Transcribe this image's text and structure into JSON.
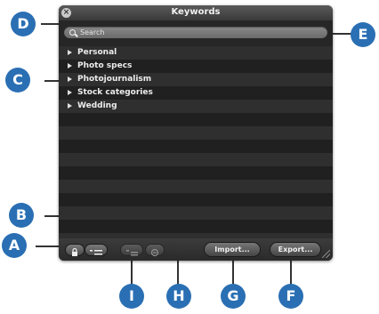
{
  "window": {
    "title": "Keywords"
  },
  "search": {
    "placeholder": "Search"
  },
  "keywords": [
    "Personal",
    "Photo specs",
    "Photojournalism",
    "Stock categories",
    "Wedding"
  ],
  "toolbar": {
    "import_label": "Import...",
    "export_label": "Export..."
  },
  "callouts": [
    "A",
    "B",
    "C",
    "D",
    "E",
    "F",
    "G",
    "H",
    "I"
  ],
  "colors": {
    "callout": "#2a6fb3",
    "panel": "#262626"
  }
}
